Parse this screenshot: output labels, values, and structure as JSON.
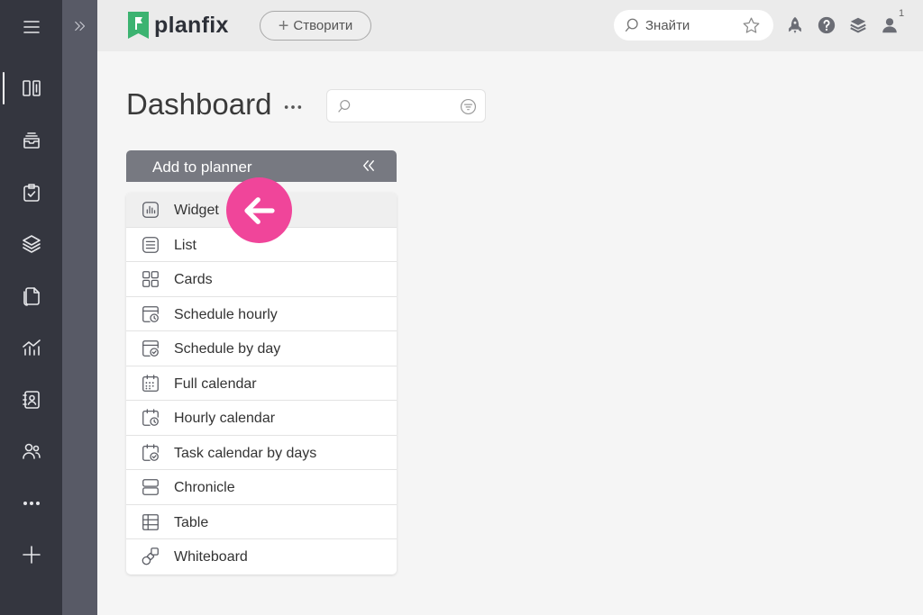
{
  "sidebar": {
    "items": [
      {
        "icon": "dashboard-icon",
        "active": true
      },
      {
        "icon": "inbox-icon"
      },
      {
        "icon": "tasks-icon"
      },
      {
        "icon": "layers-icon"
      },
      {
        "icon": "documents-icon"
      },
      {
        "icon": "analytics-icon"
      },
      {
        "icon": "contacts-icon"
      },
      {
        "icon": "team-icon"
      },
      {
        "icon": "more-icon"
      },
      {
        "icon": "add-icon"
      }
    ]
  },
  "topbar": {
    "logo_text": "planfix",
    "create_label": "Створити",
    "search_label": "Знайти",
    "notification_count": "1",
    "icons": [
      "rocket-icon",
      "help-icon",
      "layers-icon",
      "user-icon"
    ]
  },
  "main": {
    "title": "Dashboard"
  },
  "planner": {
    "header": "Add to planner",
    "items": [
      {
        "label": "Widget",
        "icon": "widget-icon"
      },
      {
        "label": "List",
        "icon": "list-icon"
      },
      {
        "label": "Cards",
        "icon": "cards-icon"
      },
      {
        "label": "Schedule hourly",
        "icon": "schedule-hourly-icon"
      },
      {
        "label": "Schedule by day",
        "icon": "schedule-by-day-icon"
      },
      {
        "label": "Full calendar",
        "icon": "full-calendar-icon"
      },
      {
        "label": "Hourly calendar",
        "icon": "hourly-calendar-icon"
      },
      {
        "label": "Task calendar by days",
        "icon": "task-calendar-icon"
      },
      {
        "label": "Chronicle",
        "icon": "chronicle-icon"
      },
      {
        "label": "Table",
        "icon": "table-icon"
      },
      {
        "label": "Whiteboard",
        "icon": "whiteboard-icon"
      }
    ]
  },
  "colors": {
    "sidebar": "#34363f",
    "accent_pink": "#f0459a",
    "logo_green": "#3cb371"
  }
}
